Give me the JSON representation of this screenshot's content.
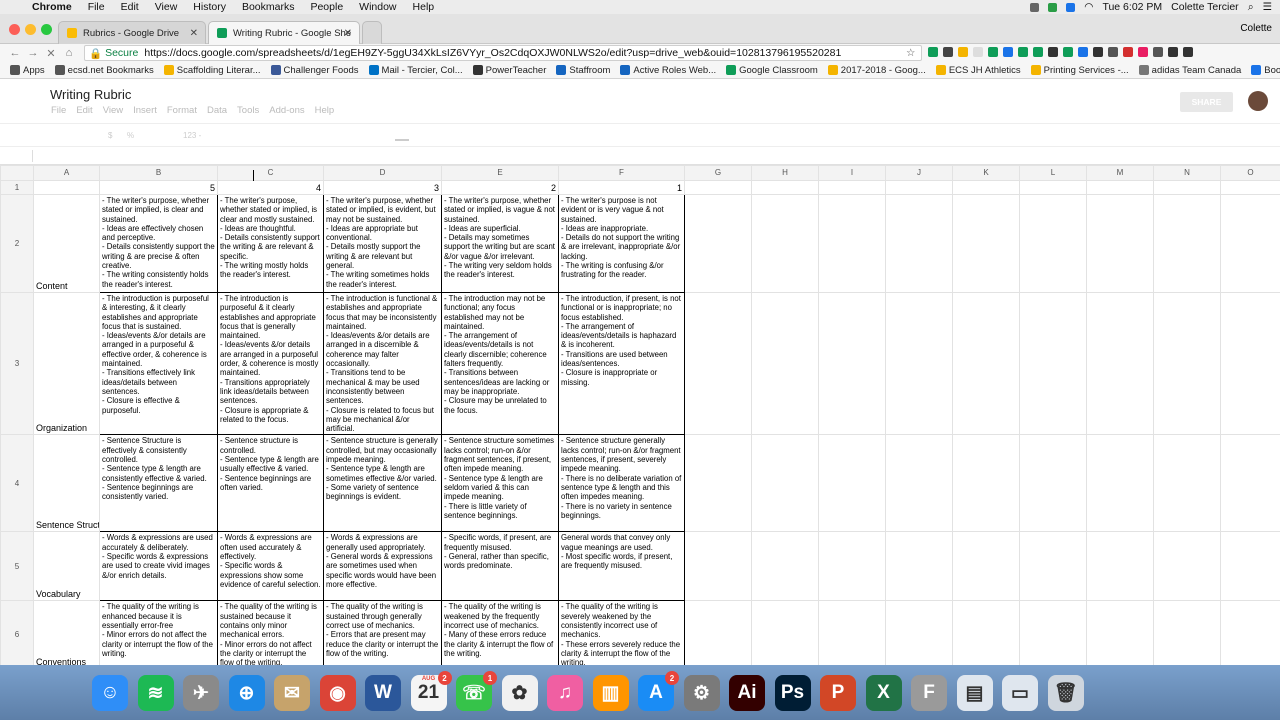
{
  "macmenu": {
    "app": "Chrome",
    "items": [
      "File",
      "Edit",
      "View",
      "History",
      "Bookmarks",
      "People",
      "Window",
      "Help"
    ],
    "clock": "Tue 6:02 PM",
    "user": "Colette Tercier"
  },
  "tabs": [
    {
      "title": "Rubrics - Google Drive",
      "color": "#fbbc05"
    },
    {
      "title": "Writing Rubric - Google Sheets",
      "color": "#0f9d58"
    }
  ],
  "window_user": "Colette",
  "address": {
    "secure": "Secure",
    "url": "https://docs.google.com/spreadsheets/d/1egEH9ZY-5ggU34XkLsIZ6VYyr_Os2CdqOXJW0NLWS2o/edit?usp=drive_web&ouid=102813796195520281"
  },
  "bookmarks": [
    {
      "label": "Apps",
      "color": "#555"
    },
    {
      "label": "ecsd.net Bookmarks",
      "color": "#555"
    },
    {
      "label": "Scaffolding Literar...",
      "color": "#f4b400"
    },
    {
      "label": "Challenger Foods",
      "color": "#3b5998"
    },
    {
      "label": "Mail - Tercier, Col...",
      "color": "#0072c6"
    },
    {
      "label": "PowerTeacher",
      "color": "#333"
    },
    {
      "label": "Staffroom",
      "color": "#1565c0"
    },
    {
      "label": "Active Roles Web...",
      "color": "#1565c0"
    },
    {
      "label": "Google Classroom",
      "color": "#0f9d58"
    },
    {
      "label": "2017-2018 - Goog...",
      "color": "#f4b400"
    },
    {
      "label": "ECS JH Athletics",
      "color": "#f4b400"
    },
    {
      "label": "Printing Services -...",
      "color": "#f4b400"
    },
    {
      "label": "adidas Team Canada",
      "color": "#777"
    },
    {
      "label": "Bookmarks",
      "color": "#1a73e8"
    }
  ],
  "sheet": {
    "title": "Writing Rubric",
    "menus": [
      "File",
      "Edit",
      "View",
      "Insert",
      "Format",
      "Data",
      "Tools",
      "Add-ons",
      "Help"
    ],
    "share_label": "SHARE",
    "toolbar": {
      "currency": "$",
      "percent": "%",
      "format": "123 -"
    },
    "columns": [
      "A",
      "B",
      "C",
      "D",
      "E",
      "F",
      "G",
      "H",
      "I",
      "J",
      "K",
      "L",
      "M",
      "N",
      "O"
    ],
    "header_row": [
      "",
      "5",
      "4",
      "3",
      "2",
      "1"
    ],
    "rows": [
      {
        "num": "2",
        "label": "Content",
        "cells": [
          "- The writer's purpose, whether stated or implied, is clear and sustained.\n- Ideas are effectively chosen and perceptive.\n- Details consistently support the writing & are precise & often creative.\n- The writing consistently holds the reader's interest.",
          "- The writer's purpose, whether stated or implied, is clear and mostly sustained.\n- Ideas are thoughtful.\n- Details consistently support the writing & are relevant & specific.\n- The writing mostly holds the reader's interest.",
          "- The writer's purpose, whether stated or implied, is evident, but may not be sustained.\n- Ideas are appropriate but conventional.\n- Details mostly support the writing & are relevant but general.\n- The writing sometimes holds the reader's interest.",
          "- The writer's purpose, whether stated or implied, is vague & not sustained.\n- Ideas are superficial.\n- Details may sometimes support the writing but are scant &/or vague &/or irrelevant.\n- The writing very seldom holds the reader's interest.",
          "- The writer's purpose is not evident or is very vague & not sustained.\n- Ideas are inappropriate.\n- Details do not support the writing & are irrelevant, inappropriate &/or lacking.\n- The writing is confusing &/or frustrating for the reader."
        ]
      },
      {
        "num": "3",
        "label": "Organization",
        "cells": [
          "- The introduction is purposeful & interesting, & it clearly establishes and appropriate focus that is sustained.\n- Ideas/events &/or details are arranged in a purposeful & effective order, & coherence is maintained.\n- Transitions effectively link ideas/details between sentences.\n- Closure is effective & purposeful.",
          "- The introduction is purposeful & it clearly establishes and appropriate focus that is generally maintained.\n- Ideas/events &/or details are arranged in a purposeful order, & coherence is mostly maintained.\n- Transitions appropriately link ideas/details between sentences.\n- Closure is appropriate & related to the focus.",
          "- The introduction is functional & establishes and appropriate focus that may be inconsistently maintained.\n- Ideas/events &/or details are arranged in a discernible & coherence may falter occasionally.\n- Transitions tend to be mechanical & may be used inconsistently between sentences.\n- Closure is related to focus but may be mechanical &/or artificial.",
          "- The introduction may not be functional; any focus established may not be maintained.\n- The arrangement of ideas/events/details is not clearly discernible; coherence falters frequently.\n- Transitions between sentences/ideas are lacking or may be inappropriate.\n- Closure may be unrelated to the focus.",
          "- The introduction, if present, is not functional or is inappropriate; no focus established.\n- The arrangement of ideas/events/details is haphazard & is incoherent.\n- Transitions are used between ideas/sentences.\n- Closure is inappropriate or missing."
        ]
      },
      {
        "num": "4",
        "label": "Sentence Structure",
        "cells": [
          "- Sentence Structure is effectively & consistently controlled.\n- Sentence type & length are consistently effective & varied.\n- Sentence beginnings are consistently varied.",
          "- Sentence structure is controlled.\n- Sentence type & length are usually effective & varied.\n- Sentence beginnings are often varied.",
          "- Sentence structure is generally controlled, but may occasionally impede meaning.\n- Sentence type & length are sometimes effective &/or varied.\n- Some variety of sentence beginnings is evident.",
          "- Sentence structure sometimes lacks control; run-on &/or fragment sentences, if present, often impede meaning.\n- Sentence type & length are seldom varied & this can impede meaning.\n- There is little variety of sentence beginnings.",
          "- Sentence structure generally lacks control; run-on &/or fragment sentences, if present, severely impede meaning.\n- There is no deliberate variation of sentence type & length and this often impedes meaning.\n- There is no variety in sentence beginnings."
        ]
      },
      {
        "num": "5",
        "label": "Vocabulary",
        "cells": [
          "- Words & expressions are used accurately & deliberately.\n- Specific words & expressions are used to create vivid images &/or enrich details.",
          "- Words & expressions are often used accurately & effectively.\n- Specific words & expressions show some evidence of careful selection.",
          "- Words & expressions are generally used appropriately.\n- General words & expressions are sometimes used when specific words would have been more effective.",
          "- Specific words, if present, are frequently misused.\n- General, rather than specific, words predominate.",
          "General words that convey only vague meanings are used.\n- Most specific words, if present, are frequently misused."
        ]
      },
      {
        "num": "6",
        "label": "Conventions",
        "cells": [
          "- The quality of the writing is enhanced because it is essentially error-free\n- Minor errors do not affect the clarity or interrupt the flow of the writing.",
          "- The quality of the writing is sustained because it contains only minor mechanical errors.\n- Minor errors do not affect the clarity or interrupt the flow of the writing.",
          "- The quality of the writing is sustained through generally correct use of mechanics.\n- Errors that are present may reduce the clarity or interrupt the flow of the writing.",
          "- The quality of the writing is weakened by the frequently incorrect use of mechanics.\n- Many of these errors reduce the clarity & interrupt the flow of the writing.",
          "- The quality of the writing is severely weakened by the consistently incorrect use of mechanics.\n- These errors severely reduce the clarity & interrupt the flow of the writing."
        ]
      }
    ]
  },
  "dock": [
    {
      "name": "finder",
      "glyph": "☺",
      "color": "#2f8ef7"
    },
    {
      "name": "spotify",
      "glyph": "≋",
      "color": "#1db954"
    },
    {
      "name": "launchpad",
      "glyph": "✈",
      "color": "#8a8a8a"
    },
    {
      "name": "safari",
      "glyph": "⊕",
      "color": "#1e88e5"
    },
    {
      "name": "mail",
      "glyph": "✉",
      "color": "#c6a36b"
    },
    {
      "name": "chrome",
      "glyph": "◉",
      "color": "#db4437"
    },
    {
      "name": "word",
      "glyph": "W",
      "color": "#2b579a"
    },
    {
      "name": "calendar",
      "glyph": "21",
      "color": "#f5f5f5",
      "badge": "2",
      "extra": "AUG"
    },
    {
      "name": "facetime",
      "glyph": "☏",
      "color": "#36c34a",
      "badge": "1"
    },
    {
      "name": "photos",
      "glyph": "✿",
      "color": "#f1f1f1"
    },
    {
      "name": "itunes",
      "glyph": "♫",
      "color": "#f05fa2"
    },
    {
      "name": "ibooks",
      "glyph": "▥",
      "color": "#ff9500"
    },
    {
      "name": "app-store",
      "glyph": "A",
      "color": "#1a8cf5",
      "badge": "2"
    },
    {
      "name": "system-preferences",
      "glyph": "⚙",
      "color": "#7a7a7a"
    },
    {
      "name": "illustrator",
      "glyph": "Ai",
      "color": "#330000"
    },
    {
      "name": "photoshop",
      "glyph": "Ps",
      "color": "#001d34"
    },
    {
      "name": "powerpoint",
      "glyph": "P",
      "color": "#d24726"
    },
    {
      "name": "excel",
      "glyph": "X",
      "color": "#217346"
    },
    {
      "name": "fontbook",
      "glyph": "F",
      "color": "#9a9a9a"
    },
    {
      "name": "documents",
      "glyph": "▤",
      "color": "#dfe6ee"
    },
    {
      "name": "downloads",
      "glyph": "▭",
      "color": "#dfe6ee"
    },
    {
      "name": "trash",
      "glyph": "🗑",
      "color": "#cfd6de"
    }
  ]
}
